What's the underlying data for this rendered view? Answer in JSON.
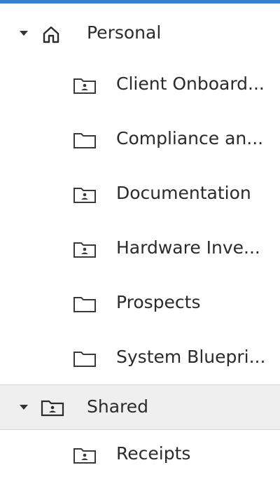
{
  "theme": {
    "accent": "#3a7fc4",
    "text": "#2b2b2b",
    "icon_stroke": "#3a3a3a",
    "selected_bg": "#efefef"
  },
  "tree": {
    "personal": {
      "label": "Personal",
      "icon": "home-icon",
      "expanded": true,
      "children": [
        {
          "label": "Client Onboard...",
          "icon": "shared-folder-icon"
        },
        {
          "label": "Compliance an...",
          "icon": "folder-icon"
        },
        {
          "label": "Documentation",
          "icon": "shared-folder-icon"
        },
        {
          "label": "Hardware Inve...",
          "icon": "shared-folder-icon"
        },
        {
          "label": "Prospects",
          "icon": "folder-icon"
        },
        {
          "label": "System Bluepri...",
          "icon": "folder-icon"
        }
      ]
    },
    "shared": {
      "label": "Shared",
      "icon": "shared-folder-icon",
      "expanded": true,
      "selected": true,
      "children": [
        {
          "label": "Receipts",
          "icon": "shared-folder-icon"
        }
      ]
    }
  }
}
